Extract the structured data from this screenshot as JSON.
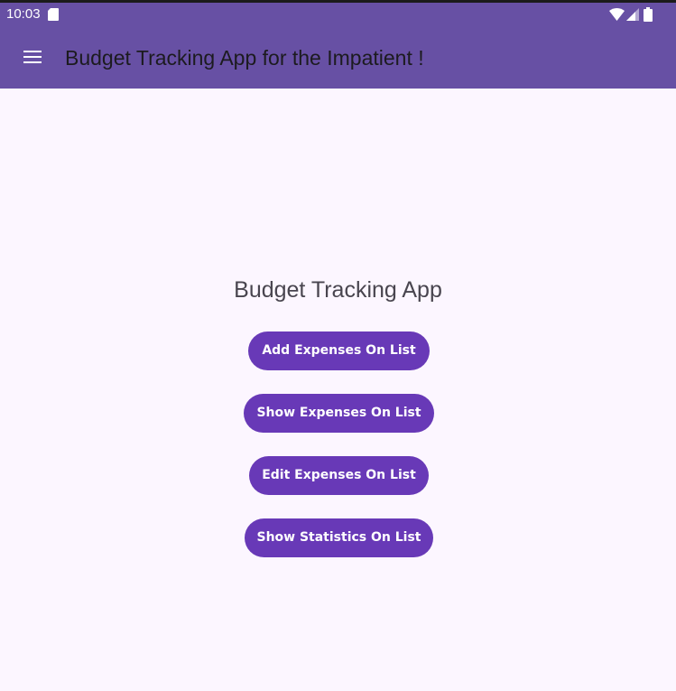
{
  "status_bar": {
    "time": "10:03",
    "icons": [
      "sd-card-icon",
      "wifi-icon",
      "cell-signal-icon",
      "battery-icon"
    ]
  },
  "app_bar": {
    "title": "Budget Tracking App for the Impatient !",
    "menu_icon": "menu-icon"
  },
  "main": {
    "heading": "Budget Tracking App",
    "buttons": [
      {
        "label": "Add Expenses On List"
      },
      {
        "label": "Show Expenses On List"
      },
      {
        "label": "Edit Expenses On List"
      },
      {
        "label": "Show Statistics On List"
      }
    ]
  },
  "colors": {
    "app_bar": "#6750a4",
    "background": "#fcf6ff",
    "button": "#6839b7",
    "heading_text": "#49454f"
  }
}
